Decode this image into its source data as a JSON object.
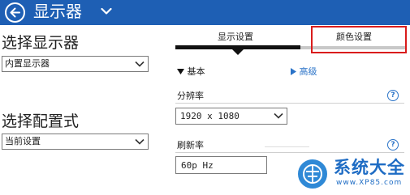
{
  "header": {
    "title": "显示器",
    "back_icon": "back-arrow-icon",
    "menu_icon": "chevron-down-icon",
    "background_color": "#1e5fb4"
  },
  "left_panel": {
    "select_display": {
      "title": "选择显示器",
      "value": "内置显示器"
    },
    "select_config": {
      "title": "选择配置式",
      "value": "当前设置"
    }
  },
  "tabs": [
    {
      "label": "显示设置",
      "active": true
    },
    {
      "label": "颜色设置",
      "active": false,
      "highlighted": true
    }
  ],
  "sections": {
    "basic": {
      "label": "基本",
      "icon": "triangle-down-icon"
    },
    "advanced": {
      "label": "高级",
      "icon": "triangle-right-icon"
    }
  },
  "fields": {
    "resolution": {
      "label": "分辨率",
      "value": "1920 x 1080"
    },
    "refresh_rate": {
      "label": "刷新率",
      "value": "60p Hz"
    }
  },
  "watermark": {
    "text": "系统大全",
    "url": "www.XP85.com"
  },
  "colors": {
    "accent": "#1e5fb4",
    "highlight_border": "#d91c1c",
    "link": "#2a73c8"
  }
}
